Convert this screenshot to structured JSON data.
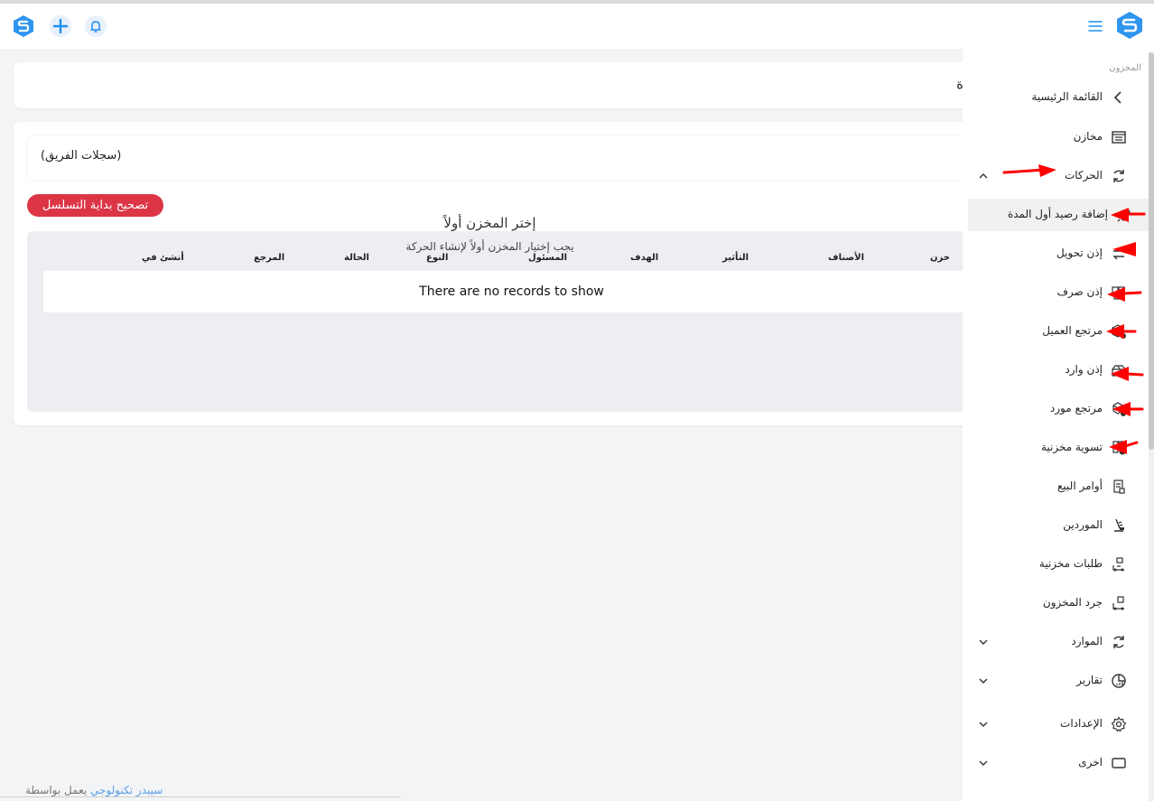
{
  "header": {
    "icons": [
      "app-logo-icon",
      "plus-icon",
      "bell-icon",
      "menu-icon",
      "app-logo-icon"
    ]
  },
  "top_card": {
    "partial_text": "ة"
  },
  "filter": {
    "team_records_label": "(سجلات الفريق)"
  },
  "fix_sequence_button": "تصحيح بداية التسلسل",
  "table": {
    "columns": [
      "خزن",
      "الأصناف",
      "التأثير",
      "الهدف",
      "المسئول",
      "النوع",
      "الحالة",
      "المرجع",
      "أنشئ في"
    ],
    "empty_message": "There are no records to show"
  },
  "empty_state": {
    "title": "إختر المخزن أولاً",
    "subtitle": "يجب إختيار المخزن أولاً لإنشاء الحركة"
  },
  "footer": {
    "prefix": "يعمل بواسطة",
    "brand": "سيبدر تكنولوجي"
  },
  "sidebar": {
    "section_title": "المخزون",
    "items": [
      {
        "label": "القائمة الرئيسية",
        "icon": "chevron-left-icon"
      },
      {
        "label": "مخازن",
        "icon": "warehouse-icon"
      },
      {
        "label": "الحركات",
        "icon": "refresh-icon",
        "chevron": "chevron-up-icon"
      },
      {
        "label": "إضافة رصيد أول المدة",
        "icon": "rocket-icon",
        "active": true
      },
      {
        "label": "إذن تحويل",
        "icon": "transfer-icon"
      },
      {
        "label": "إذن صرف",
        "icon": "boxes-out-icon"
      },
      {
        "label": "مرتجع العميل",
        "icon": "box-return-icon"
      },
      {
        "label": "إذن وارد",
        "icon": "box-in-icon"
      },
      {
        "label": "مرتجع مورد",
        "icon": "boxes-return-icon"
      },
      {
        "label": "تسوية مخزنية",
        "icon": "boxes-check-icon"
      },
      {
        "label": "أوامر البيع",
        "icon": "sales-order-icon"
      },
      {
        "label": "الموردين",
        "icon": "supplier-icon"
      },
      {
        "label": "طلبات مخزنية",
        "icon": "stock-request-icon"
      },
      {
        "label": "جرد المخزون",
        "icon": "inventory-count-icon"
      },
      {
        "label": "الموارد",
        "icon": "resources-icon",
        "chevron": "chevron-down-icon"
      },
      {
        "label": "تقارير",
        "icon": "pie-chart-icon",
        "chevron": "chevron-down-icon"
      },
      {
        "label": "الإعدادات",
        "icon": "gear-icon",
        "chevron": "chevron-down-icon"
      },
      {
        "label": "اخرى",
        "icon": "screen-icon",
        "chevron": "chevron-down-icon"
      }
    ]
  },
  "colors": {
    "accent_blue": "#1f8ef1",
    "button_red": "#dc3545",
    "annotation_red": "#ff0000"
  }
}
